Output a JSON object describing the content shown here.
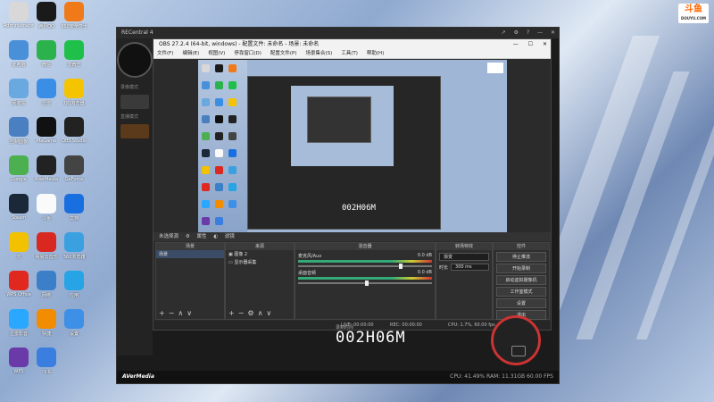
{
  "desktop": {
    "icons": [
      {
        "label": "Administrator",
        "color": "#d8d8d8"
      },
      {
        "label": "腾讯QQ",
        "color": "#1a1a1a"
      },
      {
        "label": "360安全卫士",
        "color": "#f07a1a"
      },
      {
        "label": "此电脑",
        "color": "#4a90d9"
      },
      {
        "label": "微信",
        "color": "#2bb24c"
      },
      {
        "label": "爱奇艺",
        "color": "#1ec04a"
      },
      {
        "label": "回收站",
        "color": "#6aa8e0"
      },
      {
        "label": "迅雷",
        "color": "#3a8ee6"
      },
      {
        "label": "QQ浏览器",
        "color": "#f5c400"
      },
      {
        "label": "控制面板",
        "color": "#4a7fc1"
      },
      {
        "label": "MaGame",
        "color": "#111"
      },
      {
        "label": "OBS Studio",
        "color": "#222"
      },
      {
        "label": "Google",
        "color": "#4caf50"
      },
      {
        "label": "AVerMedia",
        "color": "#222"
      },
      {
        "label": "GeForce",
        "color": "#444"
      },
      {
        "label": "Steam",
        "color": "#1b2838"
      },
      {
        "label": "斗鱼",
        "color": "#fafafa"
      },
      {
        "label": "文档",
        "color": "#1a6fe0"
      },
      {
        "label": "元",
        "color": "#f2c200"
      },
      {
        "label": "网易云音乐",
        "color": "#d9281f"
      },
      {
        "label": "360浏览器",
        "color": "#3aa0e0"
      },
      {
        "label": "WPS Office",
        "color": "#e0281f"
      },
      {
        "label": "网络",
        "color": "#3a7fc8"
      },
      {
        "label": "应用",
        "color": "#26a4e6"
      },
      {
        "label": "迅雷影音",
        "color": "#2aa7ff"
      },
      {
        "label": "快捷",
        "color": "#f28c00"
      },
      {
        "label": "设置",
        "color": "#3e8fe6"
      },
      {
        "label": "WPS",
        "color": "#6a3aa8"
      },
      {
        "label": "飞书",
        "color": "#3a7fe0"
      }
    ]
  },
  "douyu": {
    "logo": "斗鱼",
    "sub": "DOUYU.COM"
  },
  "recentral": {
    "title": "RECentral 4",
    "side_label1": "录像模式",
    "side_label2": "直播模式",
    "brand": "AVerMedia",
    "timer": "002H06M",
    "timer_label": "录制时间",
    "perf": "CPU: 41.49%  RAM: 11.31GB  60.00 FPS"
  },
  "obs": {
    "title": "OBS 27.2.4 (64-bit, windows) - 配置文件: 未命名 - 场景: 未命名",
    "menu": [
      "文件(F)",
      "编辑(E)",
      "视图(V)",
      "停靠窗口(D)",
      "配置文件(P)",
      "场景集合(S)",
      "工具(T)",
      "帮助(H)"
    ],
    "scene_bar": [
      "未选择源",
      "属性",
      "滤镜"
    ],
    "nested_timer": "002H06M",
    "docks": {
      "scenes": {
        "title": "场景",
        "items": [
          "场景"
        ]
      },
      "sources": {
        "title": "来源",
        "items": [
          "图像 2",
          "显示器采集"
        ]
      },
      "mixer": {
        "title": "混音器",
        "rows": [
          {
            "name": "麦克风/Aux",
            "db": "0.0 dB"
          },
          {
            "name": "桌面音频",
            "db": "0.0 dB"
          }
        ]
      },
      "transitions": {
        "title": "转场特效",
        "type": "渐变",
        "duration_label": "时长",
        "duration": "300 ms"
      },
      "controls": {
        "title": "控件",
        "buttons": [
          "停止推流",
          "开始录制",
          "启动虚拟摄像机",
          "工作室模式",
          "设置",
          "退出"
        ]
      }
    },
    "status": {
      "live": "LIVE: 00:00:00",
      "rec": "REC: 00:00:00",
      "cpu": "CPU: 1.7%, 60.00 fps"
    }
  }
}
